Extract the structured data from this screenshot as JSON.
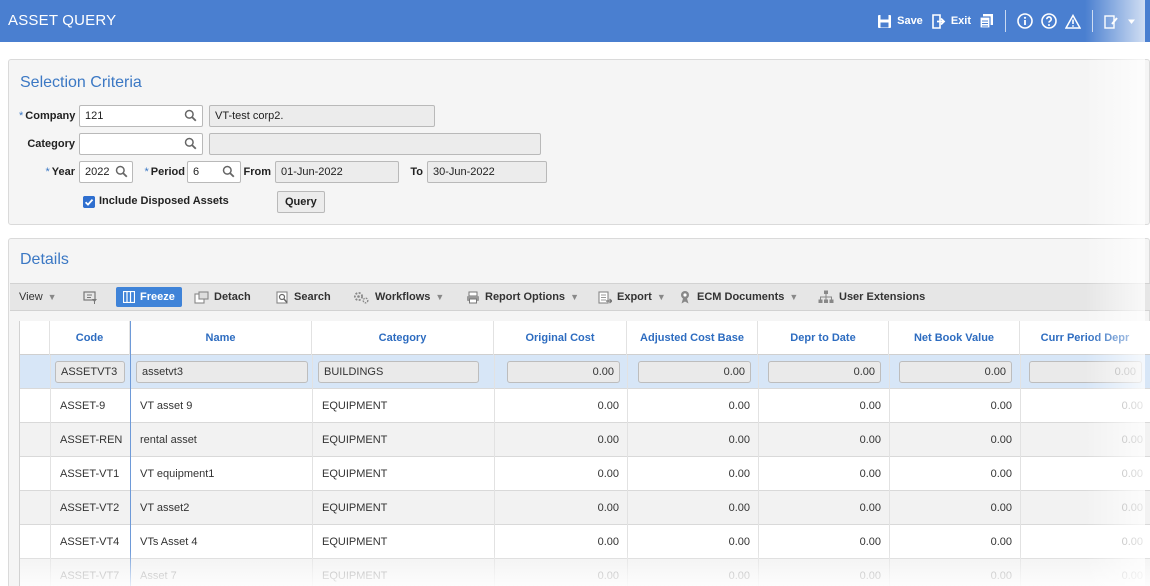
{
  "app": {
    "title": "ASSET QUERY"
  },
  "toolbar_top": {
    "save_label": "Save",
    "exit_label": "Exit"
  },
  "selection": {
    "title": "Selection Criteria",
    "company": {
      "label": "Company",
      "value": "121",
      "description": "VT-test corp2."
    },
    "category": {
      "label": "Category",
      "value": "",
      "description": ""
    },
    "year": {
      "label": "Year",
      "value": "2022"
    },
    "period": {
      "label": "Period",
      "value": "6"
    },
    "from": {
      "label": "From",
      "value": "01-Jun-2022"
    },
    "to": {
      "label": "To",
      "value": "30-Jun-2022"
    },
    "include_disposed": {
      "label": "Include Disposed Assets",
      "checked": true
    },
    "query_label": "Query"
  },
  "details": {
    "title": "Details",
    "toolbar": {
      "view": "View",
      "freeze": "Freeze",
      "detach": "Detach",
      "search": "Search",
      "workflows": "Workflows",
      "report_options": "Report Options",
      "export": "Export",
      "ecm_documents": "ECM Documents",
      "user_extensions": "User Extensions"
    },
    "columns": [
      "Code",
      "Name",
      "Category",
      "Original Cost",
      "Adjusted Cost Base",
      "Depr to Date",
      "Net Book Value",
      "Curr Period Depr"
    ],
    "rows": [
      [
        "ASSETVT3",
        "assetvt3",
        "BUILDINGS",
        "0.00",
        "0.00",
        "0.00",
        "0.00",
        "0.00"
      ],
      [
        "ASSET-9",
        "VT asset 9",
        "EQUIPMENT",
        "0.00",
        "0.00",
        "0.00",
        "0.00",
        "0.00"
      ],
      [
        "ASSET-REN",
        "rental asset",
        "EQUIPMENT",
        "0.00",
        "0.00",
        "0.00",
        "0.00",
        "0.00"
      ],
      [
        "ASSET-VT1",
        "VT equipment1",
        "EQUIPMENT",
        "0.00",
        "0.00",
        "0.00",
        "0.00",
        "0.00"
      ],
      [
        "ASSET-VT2",
        "VT asset2",
        "EQUIPMENT",
        "0.00",
        "0.00",
        "0.00",
        "0.00",
        "0.00"
      ],
      [
        "ASSET-VT4",
        "VTs Asset 4",
        "EQUIPMENT",
        "0.00",
        "0.00",
        "0.00",
        "0.00",
        "0.00"
      ],
      [
        "ASSET-VT7",
        "Asset 7",
        "EQUIPMENT",
        "0.00",
        "0.00",
        "0.00",
        "0.00",
        "0.00"
      ]
    ]
  },
  "colors": {
    "accent": "#4a7fd0",
    "header_text": "#2d6cc0",
    "selected_row": "#d7e6f7"
  }
}
